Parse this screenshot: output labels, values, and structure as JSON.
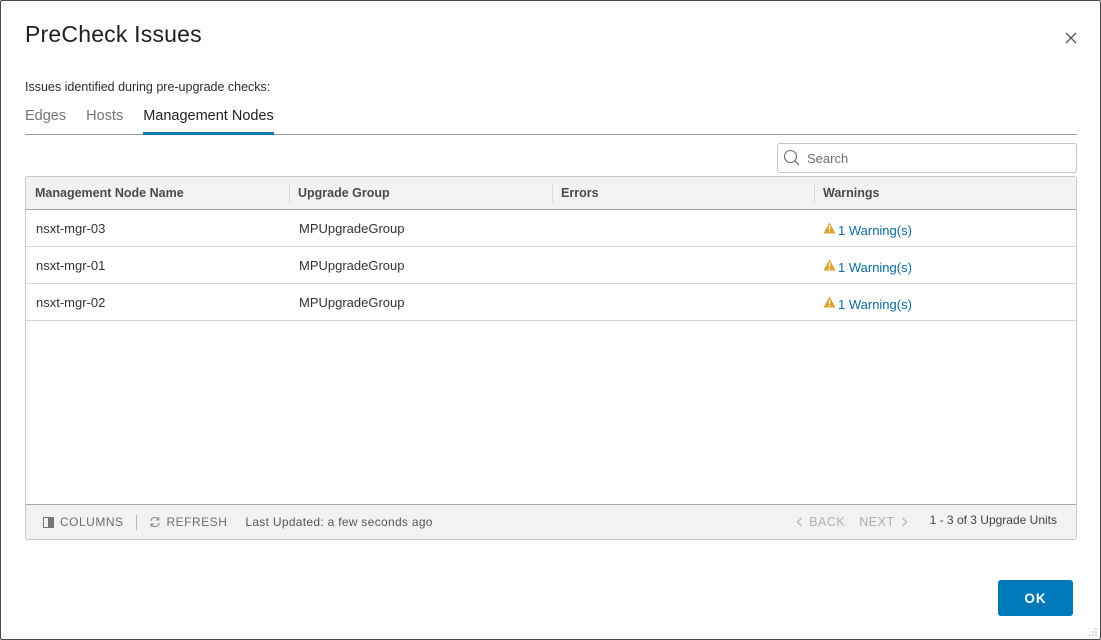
{
  "dialog": {
    "title": "PreCheck Issues",
    "subtitle": "Issues identified during pre-upgrade checks:",
    "close_icon": "close-icon"
  },
  "tabs": [
    {
      "label": "Edges",
      "active": false
    },
    {
      "label": "Hosts",
      "active": false
    },
    {
      "label": "Management Nodes",
      "active": true
    }
  ],
  "search": {
    "placeholder": "Search",
    "value": "",
    "icon": "search-icon"
  },
  "grid": {
    "columns": [
      "Management Node Name",
      "Upgrade Group",
      "Errors",
      "Warnings"
    ],
    "rows": [
      {
        "name": "nsxt-mgr-03",
        "group": "MPUpgradeGroup",
        "errors": "",
        "warnings": "1 Warning(s)"
      },
      {
        "name": "nsxt-mgr-01",
        "group": "MPUpgradeGroup",
        "errors": "",
        "warnings": "1 Warning(s)"
      },
      {
        "name": "nsxt-mgr-02",
        "group": "MPUpgradeGroup",
        "errors": "",
        "warnings": "1 Warning(s)"
      }
    ],
    "footer": {
      "columns_label": "COLUMNS",
      "refresh_label": "REFRESH",
      "last_updated": "Last Updated: a few seconds ago",
      "back_label": "BACK",
      "next_label": "NEXT",
      "count": "1 - 3 of 3 Upgrade Units"
    }
  },
  "ok_label": "OK",
  "colors": {
    "accent": "#0079b8",
    "warning": "#e0a030",
    "link": "#0b6aa2"
  }
}
